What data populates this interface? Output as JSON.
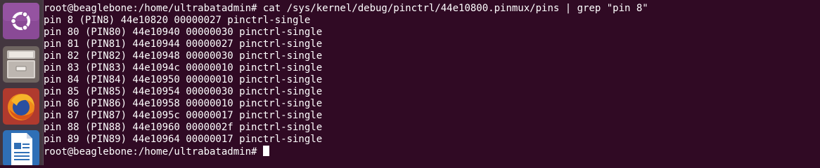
{
  "launcher": {
    "items": [
      {
        "name": "ubuntu-dash",
        "icon": "ubuntu-logo-icon"
      },
      {
        "name": "files",
        "icon": "file-cabinet-icon"
      },
      {
        "name": "firefox",
        "icon": "firefox-icon"
      },
      {
        "name": "libreoffice-writer",
        "icon": "writer-document-icon"
      }
    ],
    "colors": {
      "dash_bg": "#8a4a96",
      "files_bg": "#7a6e6a",
      "firefox_orange": "#f08a1c",
      "firefox_blue": "#2a4fa0",
      "writer_blue": "#2f6fb6"
    }
  },
  "terminal": {
    "background": "#300a24",
    "foreground": "#ffffff",
    "command_line": "root@beaglebone:/home/ultrabatadmin# cat /sys/kernel/debug/pinctrl/44e10800.pinmux/pins | grep \"pin 8\"",
    "output": [
      "pin 8 (PIN8) 44e10820 00000027 pinctrl-single",
      "pin 80 (PIN80) 44e10940 00000030 pinctrl-single",
      "pin 81 (PIN81) 44e10944 00000027 pinctrl-single",
      "pin 82 (PIN82) 44e10948 00000030 pinctrl-single",
      "pin 83 (PIN83) 44e1094c 00000010 pinctrl-single",
      "pin 84 (PIN84) 44e10950 00000010 pinctrl-single",
      "pin 85 (PIN85) 44e10954 00000030 pinctrl-single",
      "pin 86 (PIN86) 44e10958 00000010 pinctrl-single",
      "pin 87 (PIN87) 44e1095c 00000017 pinctrl-single",
      "pin 88 (PIN88) 44e10960 0000002f pinctrl-single",
      "pin 89 (PIN89) 44e10964 00000017 pinctrl-single"
    ],
    "prompt": "root@beaglebone:/home/ultrabatadmin# "
  }
}
